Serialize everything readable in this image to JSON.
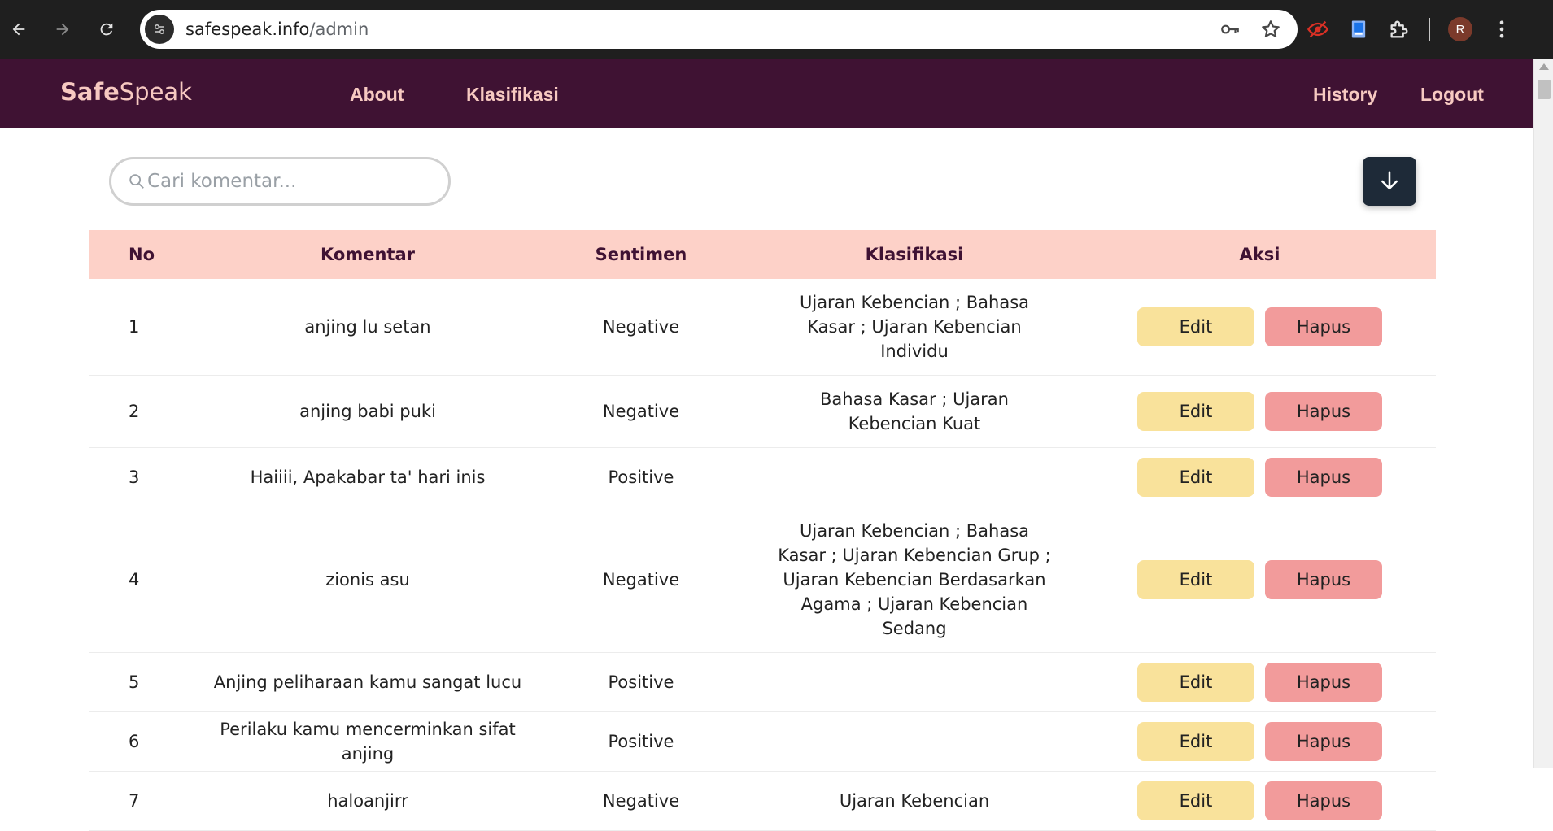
{
  "browser": {
    "url_host": "safespeak.info",
    "url_path": "/admin",
    "profile_initial": "R"
  },
  "nav": {
    "brand_bold": "Safe",
    "brand_light": "Speak",
    "about": "About",
    "klasifikasi": "Klasifikasi",
    "history": "History",
    "logout": "Logout"
  },
  "search": {
    "placeholder": "Cari komentar..."
  },
  "table": {
    "headers": {
      "no": "No",
      "komentar": "Komentar",
      "sentimen": "Sentimen",
      "klasifikasi": "Klasifikasi",
      "aksi": "Aksi"
    },
    "edit_label": "Edit",
    "hapus_label": "Hapus",
    "rows": [
      {
        "no": "1",
        "komentar": "anjing lu setan",
        "sentimen": "Negative",
        "klasifikasi": "Ujaran Kebencian ; Bahasa Kasar ; Ujaran Kebencian Individu"
      },
      {
        "no": "2",
        "komentar": "anjing babi puki",
        "sentimen": "Negative",
        "klasifikasi": "Bahasa Kasar ; Ujaran Kebencian Kuat"
      },
      {
        "no": "3",
        "komentar": "Haiiii, Apakabar ta' hari inis",
        "sentimen": "Positive",
        "klasifikasi": ""
      },
      {
        "no": "4",
        "komentar": "zionis asu",
        "sentimen": "Negative",
        "klasifikasi": "Ujaran Kebencian ; Bahasa Kasar ; Ujaran Kebencian Grup ; Ujaran Kebencian Berdasarkan Agama ; Ujaran Kebencian Sedang"
      },
      {
        "no": "5",
        "komentar": "Anjing peliharaan kamu sangat lucu",
        "sentimen": "Positive",
        "klasifikasi": ""
      },
      {
        "no": "6",
        "komentar": "Perilaku kamu mencerminkan sifat anjing",
        "sentimen": "Positive",
        "klasifikasi": ""
      },
      {
        "no": "7",
        "komentar": "haloanjirr",
        "sentimen": "Negative",
        "klasifikasi": "Ujaran Kebencian"
      }
    ]
  },
  "colors": {
    "navbar_bg": "#3f1233",
    "nav_text": "#f7c9c1",
    "header_row_bg": "#fdd1c8",
    "edit_btn": "#f9e29b",
    "hapus_btn": "#f29b9b",
    "download_btn": "#1e2a38"
  },
  "icons": {
    "back": "arrow-left-icon",
    "forward": "arrow-right-icon",
    "reload": "reload-icon",
    "site": "site-info-icon",
    "key": "key-icon",
    "star": "star-icon",
    "eye_off": "eye-off-icon",
    "book": "book-icon",
    "extensions": "puzzle-icon",
    "menu": "more-vert-icon",
    "search": "search-icon",
    "download": "arrow-down-icon"
  }
}
